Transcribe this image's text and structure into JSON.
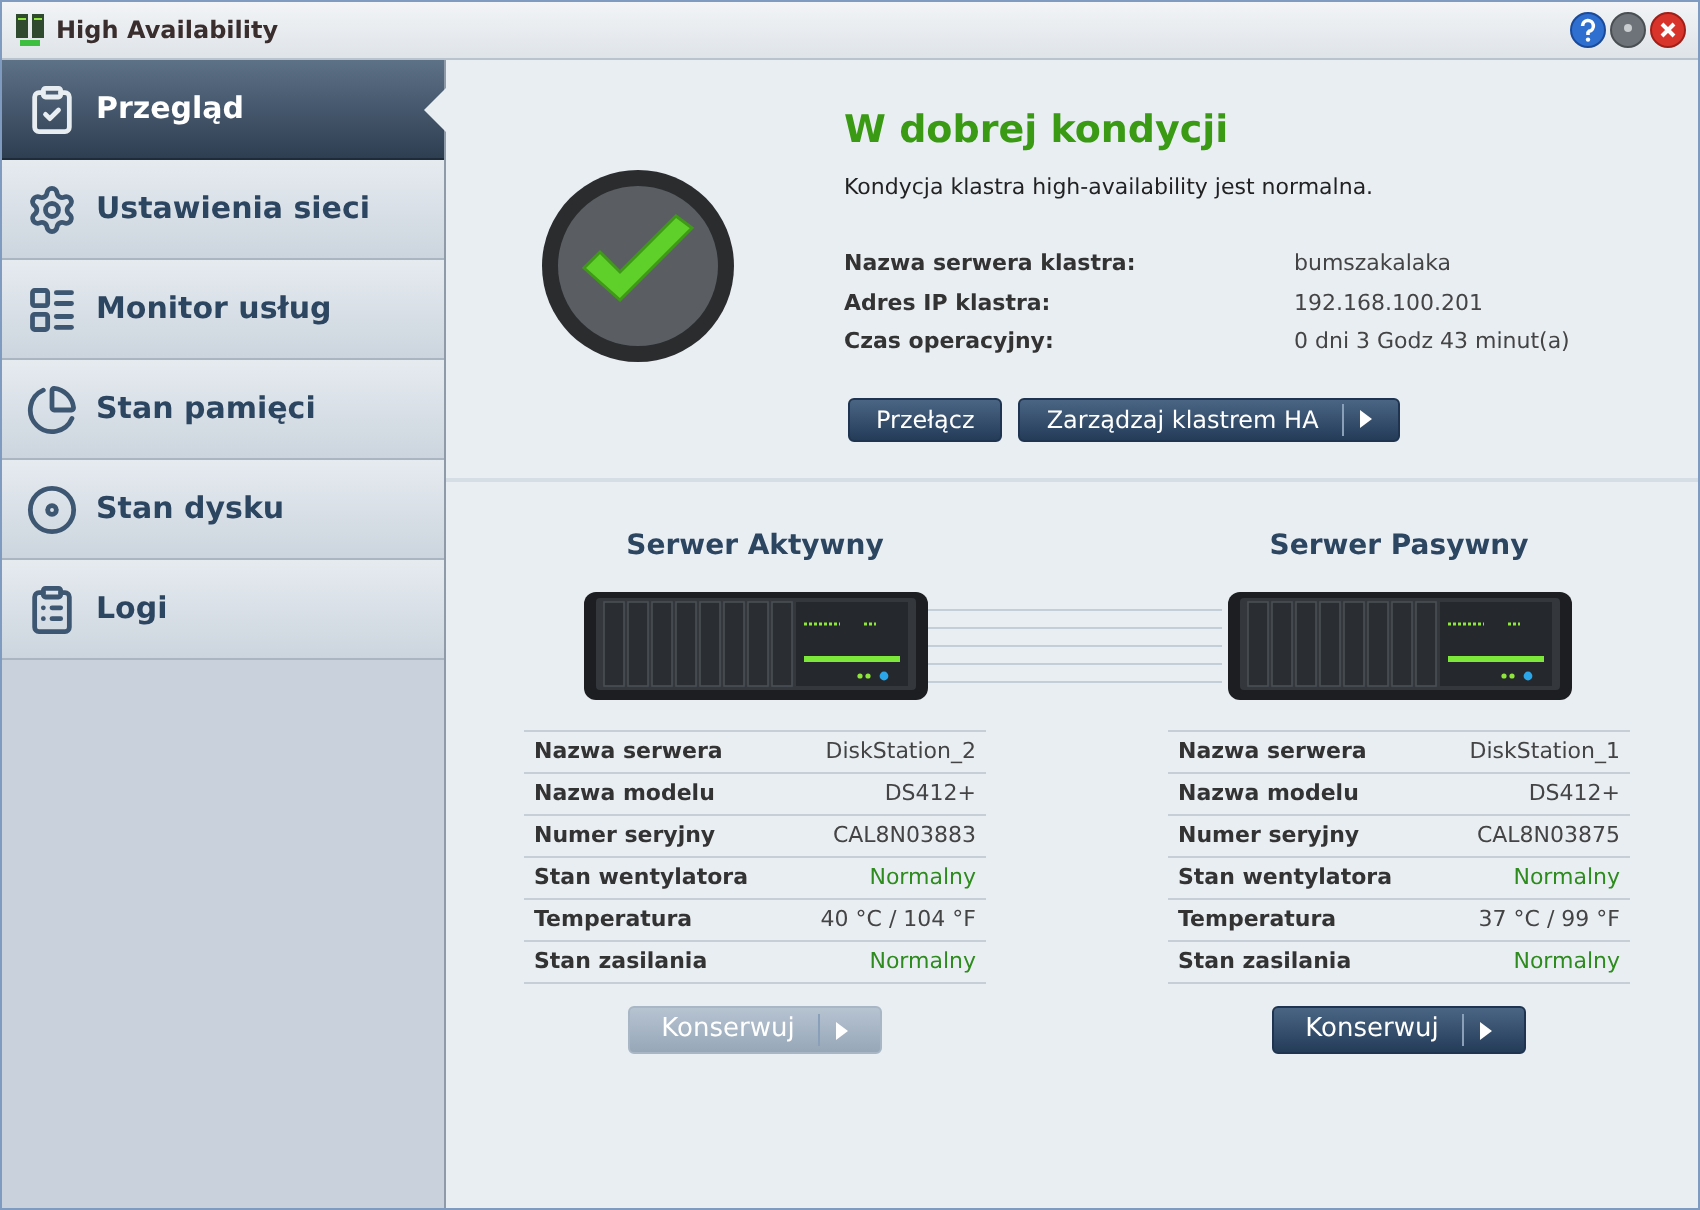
{
  "window": {
    "title": "High Availability"
  },
  "sidebar": {
    "items": [
      {
        "label": "Przegląd",
        "selected": true
      },
      {
        "label": "Ustawienia sieci",
        "selected": false
      },
      {
        "label": "Monitor usług",
        "selected": false
      },
      {
        "label": "Stan pamięci",
        "selected": false
      },
      {
        "label": "Stan dysku",
        "selected": false
      },
      {
        "label": "Logi",
        "selected": false
      }
    ]
  },
  "status": {
    "title": "W dobrej kondycji",
    "description": "Kondycja klastra high-availability jest normalna.",
    "fields": [
      {
        "label": "Nazwa serwera klastra:",
        "value": "bumszakalaka"
      },
      {
        "label": "Adres IP klastra:",
        "value": "192.168.100.201"
      },
      {
        "label": "Czas operacyjny:",
        "value": "0 dni 3 Godz 43 minut(a)"
      }
    ],
    "buttons": [
      {
        "label": "Przełącz",
        "kind": "plain"
      },
      {
        "label": "Zarządzaj klastrem HA",
        "kind": "menu"
      }
    ]
  },
  "servers": [
    {
      "title": "Serwer Aktywny",
      "rows": [
        {
          "label": "Nazwa serwera",
          "value": "DiskStation_2",
          "kind": "text"
        },
        {
          "label": "Nazwa modelu",
          "value": "DS412+",
          "kind": "text"
        },
        {
          "label": "Numer seryjny",
          "value": "CAL8N03883",
          "kind": "text"
        },
        {
          "label": "Stan wentylatora",
          "value": "Normalny",
          "kind": "status"
        },
        {
          "label": "Temperatura",
          "value": "40 °C / 104 °F",
          "kind": "text"
        },
        {
          "label": "Stan zasilania",
          "value": "Normalny",
          "kind": "status"
        }
      ],
      "button": {
        "label": "Konserwuj",
        "disabled": true
      }
    },
    {
      "title": "Serwer Pasywny",
      "rows": [
        {
          "label": "Nazwa serwera",
          "value": "DiskStation_1",
          "kind": "text"
        },
        {
          "label": "Nazwa modelu",
          "value": "DS412+",
          "kind": "text"
        },
        {
          "label": "Numer seryjny",
          "value": "CAL8N03875",
          "kind": "text"
        },
        {
          "label": "Stan wentylatora",
          "value": "Normalny",
          "kind": "status"
        },
        {
          "label": "Temperatura",
          "value": "37 °C / 99 °F",
          "kind": "text"
        },
        {
          "label": "Stan zasilania",
          "value": "Normalny",
          "kind": "status"
        }
      ],
      "button": {
        "label": "Konserwuj",
        "disabled": false
      }
    }
  ]
}
